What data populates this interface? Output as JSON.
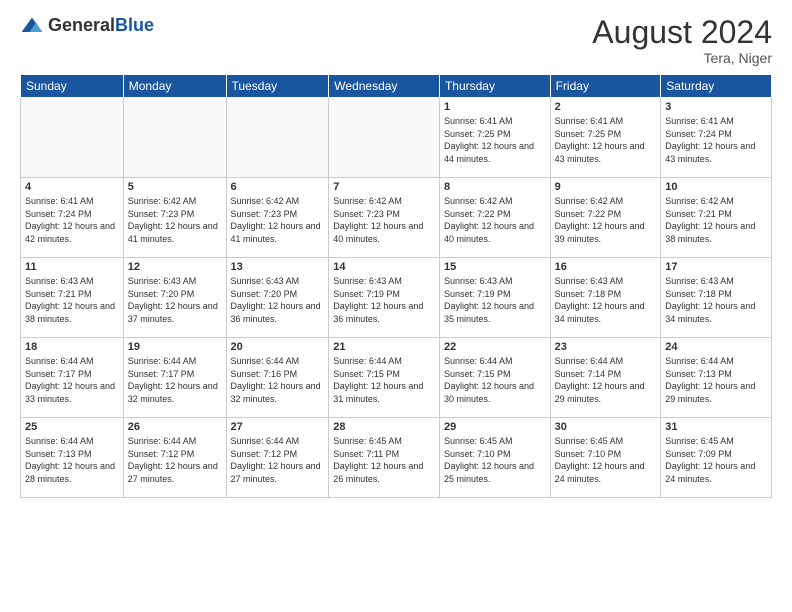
{
  "header": {
    "logo_general": "General",
    "logo_blue": "Blue",
    "month_year": "August 2024",
    "location": "Tera, Niger"
  },
  "days_of_week": [
    "Sunday",
    "Monday",
    "Tuesday",
    "Wednesday",
    "Thursday",
    "Friday",
    "Saturday"
  ],
  "weeks": [
    [
      {
        "day": "",
        "sunrise": "",
        "sunset": "",
        "daylight": "",
        "empty": true
      },
      {
        "day": "",
        "sunrise": "",
        "sunset": "",
        "daylight": "",
        "empty": true
      },
      {
        "day": "",
        "sunrise": "",
        "sunset": "",
        "daylight": "",
        "empty": true
      },
      {
        "day": "",
        "sunrise": "",
        "sunset": "",
        "daylight": "",
        "empty": true
      },
      {
        "day": "1",
        "sunrise": "Sunrise: 6:41 AM",
        "sunset": "Sunset: 7:25 PM",
        "daylight": "Daylight: 12 hours and 44 minutes.",
        "empty": false
      },
      {
        "day": "2",
        "sunrise": "Sunrise: 6:41 AM",
        "sunset": "Sunset: 7:25 PM",
        "daylight": "Daylight: 12 hours and 43 minutes.",
        "empty": false
      },
      {
        "day": "3",
        "sunrise": "Sunrise: 6:41 AM",
        "sunset": "Sunset: 7:24 PM",
        "daylight": "Daylight: 12 hours and 43 minutes.",
        "empty": false
      }
    ],
    [
      {
        "day": "4",
        "sunrise": "Sunrise: 6:41 AM",
        "sunset": "Sunset: 7:24 PM",
        "daylight": "Daylight: 12 hours and 42 minutes.",
        "empty": false
      },
      {
        "day": "5",
        "sunrise": "Sunrise: 6:42 AM",
        "sunset": "Sunset: 7:23 PM",
        "daylight": "Daylight: 12 hours and 41 minutes.",
        "empty": false
      },
      {
        "day": "6",
        "sunrise": "Sunrise: 6:42 AM",
        "sunset": "Sunset: 7:23 PM",
        "daylight": "Daylight: 12 hours and 41 minutes.",
        "empty": false
      },
      {
        "day": "7",
        "sunrise": "Sunrise: 6:42 AM",
        "sunset": "Sunset: 7:23 PM",
        "daylight": "Daylight: 12 hours and 40 minutes.",
        "empty": false
      },
      {
        "day": "8",
        "sunrise": "Sunrise: 6:42 AM",
        "sunset": "Sunset: 7:22 PM",
        "daylight": "Daylight: 12 hours and 40 minutes.",
        "empty": false
      },
      {
        "day": "9",
        "sunrise": "Sunrise: 6:42 AM",
        "sunset": "Sunset: 7:22 PM",
        "daylight": "Daylight: 12 hours and 39 minutes.",
        "empty": false
      },
      {
        "day": "10",
        "sunrise": "Sunrise: 6:42 AM",
        "sunset": "Sunset: 7:21 PM",
        "daylight": "Daylight: 12 hours and 38 minutes.",
        "empty": false
      }
    ],
    [
      {
        "day": "11",
        "sunrise": "Sunrise: 6:43 AM",
        "sunset": "Sunset: 7:21 PM",
        "daylight": "Daylight: 12 hours and 38 minutes.",
        "empty": false
      },
      {
        "day": "12",
        "sunrise": "Sunrise: 6:43 AM",
        "sunset": "Sunset: 7:20 PM",
        "daylight": "Daylight: 12 hours and 37 minutes.",
        "empty": false
      },
      {
        "day": "13",
        "sunrise": "Sunrise: 6:43 AM",
        "sunset": "Sunset: 7:20 PM",
        "daylight": "Daylight: 12 hours and 36 minutes.",
        "empty": false
      },
      {
        "day": "14",
        "sunrise": "Sunrise: 6:43 AM",
        "sunset": "Sunset: 7:19 PM",
        "daylight": "Daylight: 12 hours and 36 minutes.",
        "empty": false
      },
      {
        "day": "15",
        "sunrise": "Sunrise: 6:43 AM",
        "sunset": "Sunset: 7:19 PM",
        "daylight": "Daylight: 12 hours and 35 minutes.",
        "empty": false
      },
      {
        "day": "16",
        "sunrise": "Sunrise: 6:43 AM",
        "sunset": "Sunset: 7:18 PM",
        "daylight": "Daylight: 12 hours and 34 minutes.",
        "empty": false
      },
      {
        "day": "17",
        "sunrise": "Sunrise: 6:43 AM",
        "sunset": "Sunset: 7:18 PM",
        "daylight": "Daylight: 12 hours and 34 minutes.",
        "empty": false
      }
    ],
    [
      {
        "day": "18",
        "sunrise": "Sunrise: 6:44 AM",
        "sunset": "Sunset: 7:17 PM",
        "daylight": "Daylight: 12 hours and 33 minutes.",
        "empty": false
      },
      {
        "day": "19",
        "sunrise": "Sunrise: 6:44 AM",
        "sunset": "Sunset: 7:17 PM",
        "daylight": "Daylight: 12 hours and 32 minutes.",
        "empty": false
      },
      {
        "day": "20",
        "sunrise": "Sunrise: 6:44 AM",
        "sunset": "Sunset: 7:16 PM",
        "daylight": "Daylight: 12 hours and 32 minutes.",
        "empty": false
      },
      {
        "day": "21",
        "sunrise": "Sunrise: 6:44 AM",
        "sunset": "Sunset: 7:15 PM",
        "daylight": "Daylight: 12 hours and 31 minutes.",
        "empty": false
      },
      {
        "day": "22",
        "sunrise": "Sunrise: 6:44 AM",
        "sunset": "Sunset: 7:15 PM",
        "daylight": "Daylight: 12 hours and 30 minutes.",
        "empty": false
      },
      {
        "day": "23",
        "sunrise": "Sunrise: 6:44 AM",
        "sunset": "Sunset: 7:14 PM",
        "daylight": "Daylight: 12 hours and 29 minutes.",
        "empty": false
      },
      {
        "day": "24",
        "sunrise": "Sunrise: 6:44 AM",
        "sunset": "Sunset: 7:13 PM",
        "daylight": "Daylight: 12 hours and 29 minutes.",
        "empty": false
      }
    ],
    [
      {
        "day": "25",
        "sunrise": "Sunrise: 6:44 AM",
        "sunset": "Sunset: 7:13 PM",
        "daylight": "Daylight: 12 hours and 28 minutes.",
        "empty": false
      },
      {
        "day": "26",
        "sunrise": "Sunrise: 6:44 AM",
        "sunset": "Sunset: 7:12 PM",
        "daylight": "Daylight: 12 hours and 27 minutes.",
        "empty": false
      },
      {
        "day": "27",
        "sunrise": "Sunrise: 6:44 AM",
        "sunset": "Sunset: 7:12 PM",
        "daylight": "Daylight: 12 hours and 27 minutes.",
        "empty": false
      },
      {
        "day": "28",
        "sunrise": "Sunrise: 6:45 AM",
        "sunset": "Sunset: 7:11 PM",
        "daylight": "Daylight: 12 hours and 26 minutes.",
        "empty": false
      },
      {
        "day": "29",
        "sunrise": "Sunrise: 6:45 AM",
        "sunset": "Sunset: 7:10 PM",
        "daylight": "Daylight: 12 hours and 25 minutes.",
        "empty": false
      },
      {
        "day": "30",
        "sunrise": "Sunrise: 6:45 AM",
        "sunset": "Sunset: 7:10 PM",
        "daylight": "Daylight: 12 hours and 24 minutes.",
        "empty": false
      },
      {
        "day": "31",
        "sunrise": "Sunrise: 6:45 AM",
        "sunset": "Sunset: 7:09 PM",
        "daylight": "Daylight: 12 hours and 24 minutes.",
        "empty": false
      }
    ]
  ]
}
